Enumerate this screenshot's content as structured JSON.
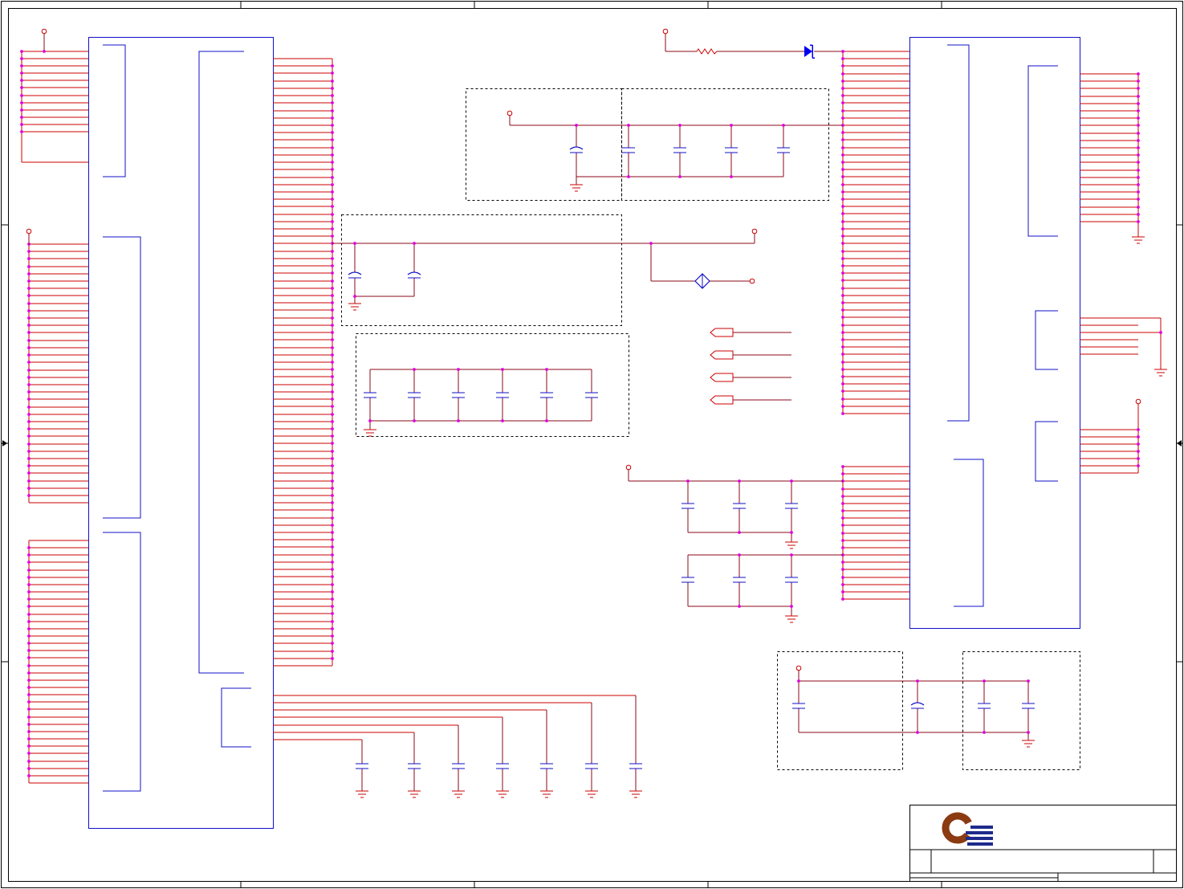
{
  "colors": {
    "background": "#FFFFFF",
    "frame": "#000000",
    "dashed_box": "#000000",
    "component_outline": "#1010C8",
    "pin": "#CC0000",
    "wire": "#8B0A1A",
    "junction": "#E000E0",
    "capacitor_plate": "#1010C8",
    "power_symbol": "#CC0000",
    "ground_symbol": "#CC0000",
    "diode": "#0000F0",
    "ferrite_bead": "#1010C8",
    "logo_ring": "#8B3A12",
    "logo_stripes": "#1E2A8C"
  },
  "symbols": [
    "power-icon",
    "ground-icon",
    "capacitor-icon",
    "polarized-capacitor-icon",
    "resistor-icon",
    "diode-icon",
    "ferrite-bead-icon",
    "port-icon",
    "company-logo"
  ]
}
